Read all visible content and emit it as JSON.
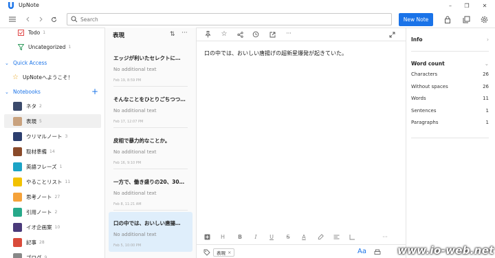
{
  "app": {
    "title": "UpNote"
  },
  "window_controls": {
    "minimize": "–",
    "maximize": "❐",
    "close": "✕"
  },
  "toolbar": {
    "search_placeholder": "Search",
    "new_note_label": "New Note"
  },
  "sidebar": {
    "top_items": [
      {
        "label": "Todo",
        "count": "1",
        "icon": "checkbox-icon"
      },
      {
        "label": "Uncategorized",
        "count": "1",
        "icon": "filter-icon"
      }
    ],
    "quick_access": {
      "heading": "Quick Access",
      "items": [
        {
          "label": "UpNoteへようこそ！",
          "icon": "star-icon"
        }
      ]
    },
    "notebooks": {
      "heading": "Notebooks",
      "add_label": "+",
      "items": [
        {
          "label": "ネタ",
          "count": "2",
          "color": "#3b4a6b"
        },
        {
          "label": "表現",
          "count": "5",
          "color": "#c9a27e",
          "selected": true
        },
        {
          "label": "ウリマルノート",
          "count": "3",
          "color": "#2c3e6e"
        },
        {
          "label": "取材準備",
          "count": "14",
          "color": "#8a4a2a"
        },
        {
          "label": "英語フレーズ",
          "count": "1",
          "color": "#1ba3c6"
        },
        {
          "label": "やることリスト",
          "count": "11",
          "color": "#f2c200"
        },
        {
          "label": "思考ノート",
          "count": "27",
          "color": "#f5a23a"
        },
        {
          "label": "引用ノート",
          "count": "2",
          "color": "#27a98a"
        },
        {
          "label": "イオ企画案",
          "count": "10",
          "color": "#4a3a7a"
        },
        {
          "label": "記事",
          "count": "28",
          "color": "#d94a3a"
        },
        {
          "label": "ブログ",
          "count": "9",
          "color": "#888888"
        }
      ]
    }
  },
  "note_list": {
    "title": "表現",
    "notes": [
      {
        "title": "エッジが利いたセレクトに…",
        "snippet": "No additional text",
        "date": "Feb 19, 8:59 PM"
      },
      {
        "title": "そんなことをひとりごちつつ…",
        "snippet": "No additional text",
        "date": "Feb 17, 12:07 PM"
      },
      {
        "title": "皮相で暴力的なことか。",
        "snippet": "No additional text",
        "date": "Feb 16, 9:10 PM"
      },
      {
        "title": "一方で、働き盛りの20、30…",
        "snippet": "No additional text",
        "date": "Feb 8, 11:21 AM"
      },
      {
        "title": "口の中では、おいしい唐揚…",
        "snippet": "No additional text",
        "date": "Feb 5, 10:00 PM",
        "active": true
      }
    ]
  },
  "editor": {
    "body": "口の中では、おいしい唐揚げの超新星爆発が起きていた。",
    "tag": "表現",
    "tag_remove": "×",
    "font_button": "Aa",
    "format_labels": {
      "heading": "H",
      "bold": "B",
      "italic": "I",
      "underline": "U",
      "strike": "S",
      "color": "A"
    },
    "more": "···"
  },
  "info_panel": {
    "info_heading": "Info",
    "word_count_heading": "Word count",
    "stats": [
      {
        "label": "Characters",
        "value": "26"
      },
      {
        "label": "Without spaces",
        "value": "26"
      },
      {
        "label": "Words",
        "value": "11"
      },
      {
        "label": "Sentences",
        "value": "1"
      },
      {
        "label": "Paragraphs",
        "value": "1"
      }
    ]
  },
  "watermark": "www.io-web.net",
  "colors": {
    "accent": "#1a73e8",
    "selected_note": "#dfeefb"
  }
}
